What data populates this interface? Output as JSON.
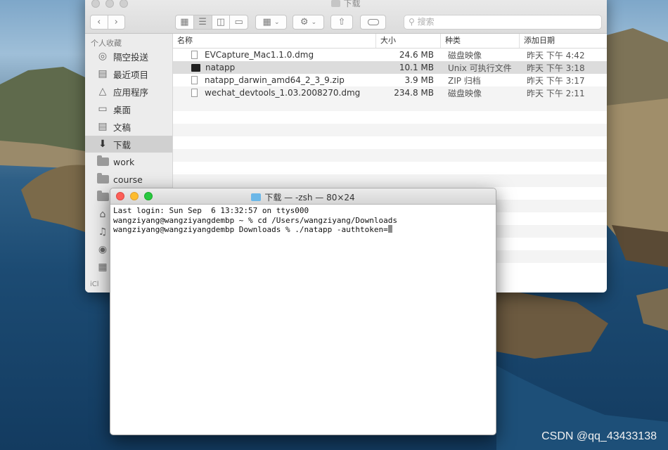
{
  "finder": {
    "title": "下载",
    "search_placeholder": "搜索",
    "sidebar": {
      "heading": "个人收藏",
      "items": [
        {
          "label": "隔空投送",
          "icon": "airdrop-icon"
        },
        {
          "label": "最近项目",
          "icon": "recents-icon"
        },
        {
          "label": "应用程序",
          "icon": "applications-icon"
        },
        {
          "label": "桌面",
          "icon": "desktop-icon"
        },
        {
          "label": "文稿",
          "icon": "documents-icon"
        },
        {
          "label": "下载",
          "icon": "downloads-icon",
          "selected": true
        },
        {
          "label": "work",
          "icon": "folder-icon"
        },
        {
          "label": "course",
          "icon": "folder-icon"
        }
      ],
      "footer_fragment": "iCl"
    },
    "columns": {
      "name": "名称",
      "size": "大小",
      "kind": "种类",
      "date": "添加日期"
    },
    "files": [
      {
        "name": "EVCapture_Mac1.1.0.dmg",
        "size": "24.6 MB",
        "kind": "磁盘映像",
        "date": "昨天 下午 4:42",
        "icon": "disk-image-icon"
      },
      {
        "name": "natapp",
        "size": "10.1 MB",
        "kind": "Unix 可执行文件",
        "date": "昨天 下午 3:18",
        "icon": "executable-icon",
        "selected": true
      },
      {
        "name": "natapp_darwin_amd64_2_3_9.zip",
        "size": "3.9 MB",
        "kind": "ZIP 归档",
        "date": "昨天 下午 3:17",
        "icon": "zip-icon"
      },
      {
        "name": "wechat_devtools_1.03.2008270.dmg",
        "size": "234.8 MB",
        "kind": "磁盘映像",
        "date": "昨天 下午 2:11",
        "icon": "disk-image-icon"
      }
    ]
  },
  "terminal": {
    "title": "下载 — -zsh — 80×24",
    "lines": [
      "Last login: Sun Sep  6 13:32:57 on ttys000",
      "wangziyang@wangziyangdembp ~ % cd /Users/wangziyang/Downloads",
      "wangziyang@wangziyangdembp Downloads % ./natapp -authtoken="
    ]
  },
  "watermark": "CSDN @qq_43433138",
  "colors": {
    "close": "#fc5f57",
    "minimize": "#fdbc2e",
    "zoom": "#28c840"
  }
}
